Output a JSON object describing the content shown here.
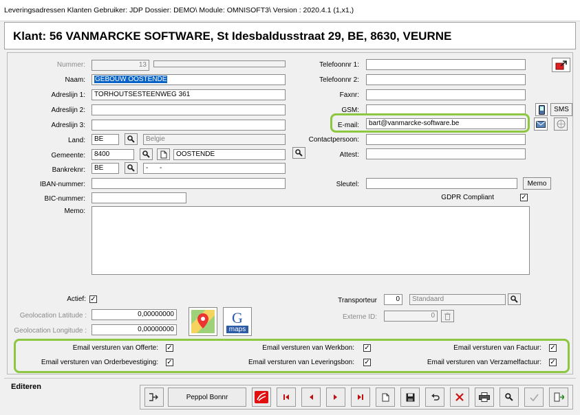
{
  "titlebar": {
    "text": "Leveringsadressen Klanten   Gebruiker: JDP   Dossier: DEMO\\   Module: OMNISOFT3\\   Version : 2020.4.1 (1,x1,)"
  },
  "header": {
    "title": "Klant: 56 VANMARCKE SOFTWARE, St Idesbaldusstraat 29, BE, 8630, VEURNE"
  },
  "form": {
    "nummer": {
      "label": "Nummer:",
      "value": "13"
    },
    "naam": {
      "label": "Naam:",
      "value": "GEBOUW OOSTENDE"
    },
    "adreslijn1": {
      "label": "Adreslijn 1:",
      "value": "TORHOUTSESTEENWEG 361"
    },
    "adreslijn2": {
      "label": "Adreslijn 2:",
      "value": ""
    },
    "adreslijn3": {
      "label": "Adreslijn 3:",
      "value": ""
    },
    "land": {
      "label": "Land:",
      "code": "BE",
      "name": "Belgie"
    },
    "gemeente": {
      "label": "Gemeente:",
      "postcode": "8400",
      "name": "OOSTENDE"
    },
    "bankreknr": {
      "label": "Bankreknr:",
      "code": "BE",
      "value": "-      -"
    },
    "iban": {
      "label": "IBAN-nummer:",
      "value": ""
    },
    "bic": {
      "label": "BIC-nummer:",
      "value": ""
    },
    "memo": {
      "label": "Memo:",
      "value": ""
    },
    "telefoon1": {
      "label": "Telefoonnr 1:",
      "value": ""
    },
    "telefoon2": {
      "label": "Telefoonnr 2:",
      "value": ""
    },
    "faxnr": {
      "label": "Faxnr:",
      "value": ""
    },
    "gsm": {
      "label": "GSM:",
      "value": "",
      "sms_label": "SMS"
    },
    "email": {
      "label": "E-mail:",
      "value": "bart@vanmarcke-software.be"
    },
    "contactpersoon": {
      "label": "Contactpersoon:",
      "value": ""
    },
    "attest": {
      "label": "Attest:",
      "value": ""
    },
    "sleutel": {
      "label": "Sleutel:",
      "value": "",
      "memo_label": "Memo"
    },
    "gdpr": {
      "label": "GDPR Compliant",
      "checked": true
    },
    "actief": {
      "label": "Actief:",
      "checked": true
    },
    "geo_lat": {
      "label": "Geolocation Latitude :",
      "value": "0,00000000"
    },
    "geo_lon": {
      "label": "Geolocation Longitude :",
      "value": "0,00000000"
    },
    "transporteur": {
      "label": "Transporteur",
      "code": "0",
      "name": "Standaard"
    },
    "externe_id": {
      "label": "Externe ID:",
      "value": "0"
    },
    "maps_label": "maps",
    "maps_g": "G"
  },
  "email_options": [
    {
      "label": "Email versturen van Offerte:",
      "checked": true
    },
    {
      "label": "Email versturen van Werkbon:",
      "checked": true
    },
    {
      "label": "Email versturen van Factuur:",
      "checked": true
    },
    {
      "label": "Email versturen van Orderbevestiging:",
      "checked": true
    },
    {
      "label": "Email versturen van Leveringsbon:",
      "checked": true
    },
    {
      "label": "Email versturen van Verzamelfactuur:",
      "checked": true
    }
  ],
  "bottom": {
    "mode_label": "Editeren",
    "peppol_label": "Peppol Bonnr"
  },
  "colors": {
    "highlight": "#8dc63f",
    "selection": "#0a64c8",
    "delete_red": "#d01010"
  }
}
